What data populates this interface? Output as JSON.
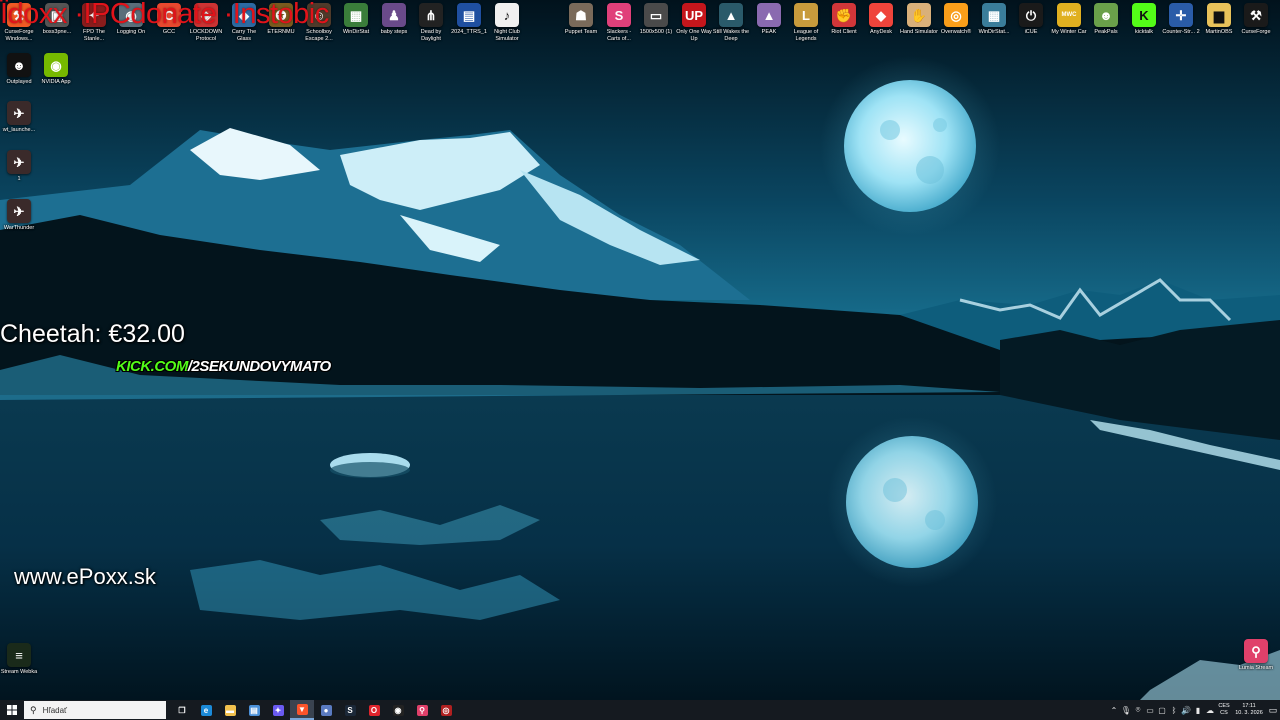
{
  "overlays": {
    "ticker": "Ïdoxx  ·IPCdonate  ·Instobic",
    "cheetah": "Cheetah: €32.00",
    "kick_domain": "KICK.COM",
    "kick_channel": "/2SEKUNDOVYMATO",
    "website": "www.ePoxx.sk"
  },
  "desktop_icons_top": [
    {
      "label": "CurseForge Windows...",
      "color": "#f15a24",
      "glyph": "⚒"
    },
    {
      "label": "boss3pne...",
      "color": "#555555",
      "glyph": "▣"
    },
    {
      "label": "FPD The Stanle...",
      "color": "#8a1c1c",
      "glyph": "✦"
    },
    {
      "label": "Logging On",
      "color": "#5a6e7a",
      "glyph": "◉"
    },
    {
      "label": "GCC",
      "color": "#e8482f",
      "glyph": "C"
    },
    {
      "label": "LOCKDOWN Protocol",
      "color": "#c33",
      "glyph": "◈"
    },
    {
      "label": "Carry The Glass",
      "color": "#2d6aa3",
      "glyph": "◆"
    },
    {
      "label": "ETERNMU",
      "color": "#7a5a1e",
      "glyph": "✪"
    },
    {
      "label": "Schoolboy Escape 2...",
      "color": "#4f3a2a",
      "glyph": "☺"
    },
    {
      "label": "WinDirStat",
      "color": "#3a7d3a",
      "glyph": "▦"
    },
    {
      "label": "baby steps",
      "color": "#6a4a8a",
      "glyph": "♟"
    },
    {
      "label": "Dead by Daylight",
      "color": "#222222",
      "glyph": "⋔"
    },
    {
      "label": "2024_TTRS_1",
      "color": "#1f4fa0",
      "glyph": "▤"
    },
    {
      "label": "Night Club Simulator",
      "color": "#f0f0f0",
      "glyph": "♪"
    },
    {
      "label": "Puppet Team",
      "color": "#7a6a5a",
      "glyph": "☗"
    },
    {
      "label": "Slackers - Carts of...",
      "color": "#e0407a",
      "glyph": "S"
    },
    {
      "label": "1500x500 (1)",
      "color": "#4a4a4a",
      "glyph": "▭"
    },
    {
      "label": "Only One Way Up",
      "color": "#c4161c",
      "glyph": "UP"
    },
    {
      "label": "Still Wakes the Deep",
      "color": "#2a5a6a",
      "glyph": "▲"
    },
    {
      "label": "PEAK",
      "color": "#8a6ab0",
      "glyph": "▲"
    },
    {
      "label": "League of Legends",
      "color": "#c89b3c",
      "glyph": "L"
    },
    {
      "label": "Riot Client",
      "color": "#d13639",
      "glyph": "✊"
    },
    {
      "label": "AnyDesk",
      "color": "#ef443b",
      "glyph": "◆"
    },
    {
      "label": "Hand Simulator",
      "color": "#d9b07a",
      "glyph": "✋"
    },
    {
      "label": "Overwatch®",
      "color": "#f99e1a",
      "glyph": "◎"
    },
    {
      "label": "WinDirStat...",
      "color": "#3a7d9a",
      "glyph": "▦"
    },
    {
      "label": "iCUE",
      "color": "#1a1a1a",
      "glyph": "⏻"
    },
    {
      "label": "My Winter Car",
      "color": "#e0b020",
      "glyph": "MWC"
    },
    {
      "label": "PeakPals",
      "color": "#6aa04a",
      "glyph": "☻"
    },
    {
      "label": "kicktalk",
      "color": "#53fc18",
      "glyph": "K"
    },
    {
      "label": "Counter-Str... 2",
      "color": "#2a5ca8",
      "glyph": "✛"
    },
    {
      "label": "MartinOBS",
      "color": "#e8c25a",
      "glyph": "▆"
    },
    {
      "label": "CurseForge",
      "color": "#1a1a1a",
      "glyph": "⚒"
    }
  ],
  "desktop_icons_left": [
    {
      "label": "Outplayed",
      "color": "#111111",
      "glyph": "☻"
    },
    {
      "label": "NVIDIA App",
      "color": "#76b900",
      "glyph": "◉"
    },
    {
      "label": "wt_launche...",
      "color": "#3a2a2a",
      "glyph": "✈"
    },
    {
      "label": "1",
      "color": "#3a2a2a",
      "glyph": "✈"
    },
    {
      "label": "WarThunder",
      "color": "#3a2a2a",
      "glyph": "✈"
    },
    {
      "label": "Stream Webka",
      "color": "#1a2a1a",
      "glyph": "≡"
    },
    {
      "label": "Lumia Stream",
      "color": "#e0406a",
      "glyph": "⚲"
    }
  ],
  "taskbar": {
    "search_placeholder": "Hľadať",
    "pinned": [
      {
        "name": "task-view",
        "glyph": "❐",
        "color": "transparent"
      },
      {
        "name": "edge",
        "glyph": "e",
        "color": "#1b8ad8"
      },
      {
        "name": "file-explorer",
        "glyph": "▬",
        "color": "#f2c14e"
      },
      {
        "name": "notepad",
        "glyph": "▤",
        "color": "#4a90d9"
      },
      {
        "name": "copilot",
        "glyph": "✦",
        "color": "#6a5af0"
      },
      {
        "name": "brave",
        "glyph": "▼",
        "color": "#fb542b"
      },
      {
        "name": "app-blue",
        "glyph": "●",
        "color": "#5a7ac0"
      },
      {
        "name": "steam",
        "glyph": "S",
        "color": "#1b2838"
      },
      {
        "name": "opera",
        "glyph": "O",
        "color": "#e0242c"
      },
      {
        "name": "obs",
        "glyph": "◉",
        "color": "#222222"
      },
      {
        "name": "lumia",
        "glyph": "⚲",
        "color": "#e0406a"
      },
      {
        "name": "app-red",
        "glyph": "◎",
        "color": "#b02020"
      }
    ],
    "language_top": "CES",
    "language_bottom": "CS",
    "time": "17:11",
    "date": "10. 3. 2026"
  },
  "colors": {
    "overlay_red": "#e0131a",
    "kick_green": "#53fc18",
    "taskbar_bg": "#151a20"
  }
}
